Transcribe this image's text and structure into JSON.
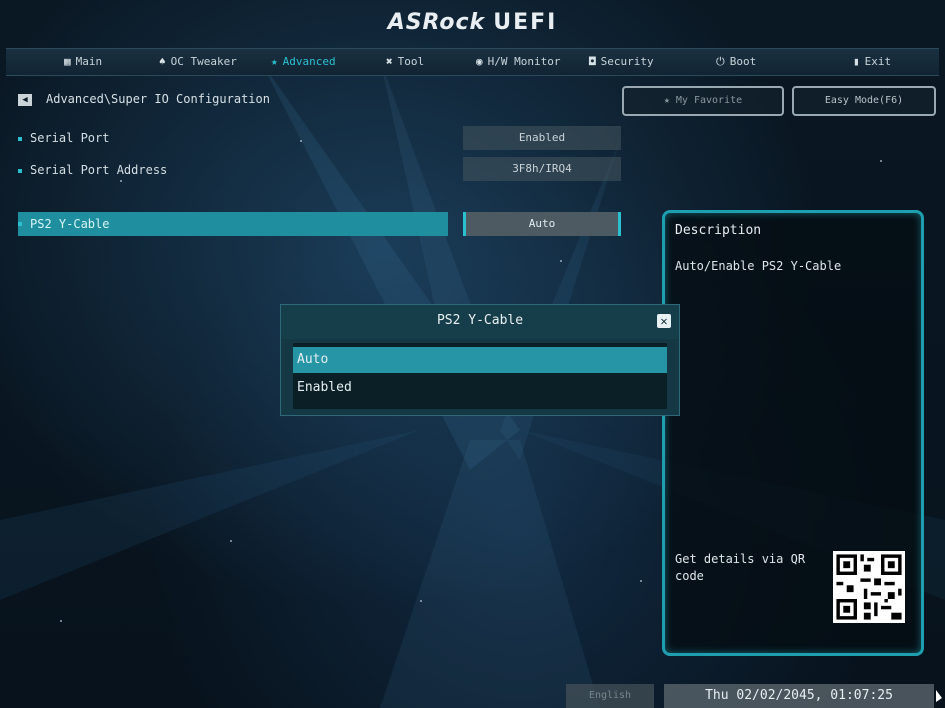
{
  "brand": {
    "name": "ASRock",
    "suffix": "UEFI"
  },
  "tabs": [
    {
      "icon": "grid-icon",
      "glyph": "▦",
      "label": "Main"
    },
    {
      "icon": "rocket-icon",
      "glyph": "♠",
      "label": "OC Tweaker"
    },
    {
      "icon": "star-icon",
      "glyph": "★",
      "label": "Advanced",
      "active": true
    },
    {
      "icon": "tool-icon",
      "glyph": "✖",
      "label": "Tool"
    },
    {
      "icon": "monitor-icon",
      "glyph": "◉",
      "label": "H/W Monitor"
    },
    {
      "icon": "shield-icon",
      "glyph": "◘",
      "label": "Security"
    },
    {
      "icon": "power-icon",
      "glyph": "⏻",
      "label": "Boot"
    },
    {
      "icon": "exit-icon",
      "glyph": "▮",
      "label": "Exit"
    }
  ],
  "breadcrumb": "Advanced\\Super IO Configuration",
  "buttons": {
    "favorite": "★  My Favorite",
    "easy_mode": "Easy Mode(F6)"
  },
  "settings": [
    {
      "label": "Serial Port",
      "value": "Enabled"
    },
    {
      "label": "Serial Port Address",
      "value": "3F8h/IRQ4"
    },
    {
      "label": "PS2 Y-Cable",
      "value": "Auto",
      "selected": true
    }
  ],
  "description": {
    "title": "Description",
    "text": "Auto/Enable PS2 Y-Cable",
    "qr_label": "Get details via QR code"
  },
  "dialog": {
    "title": "PS2 Y-Cable",
    "options": [
      "Auto",
      "Enabled"
    ],
    "selected_index": 0
  },
  "footer": {
    "language": "English",
    "datetime": "Thu 02/02/2045, 01:07:25"
  },
  "colors": {
    "accent": "#2bc0d0",
    "highlight": "#1f8fa0"
  }
}
